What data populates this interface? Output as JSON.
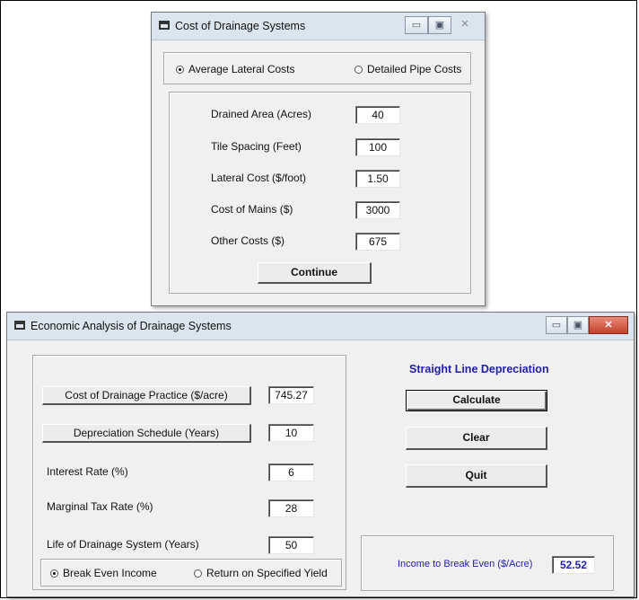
{
  "cost_window": {
    "title": "Cost of Drainage Systems",
    "controls": {
      "minimize": "▭",
      "maximize": "▣",
      "close": "✕"
    },
    "radio_average": "Average Lateral Costs",
    "radio_detailed": "Detailed Pipe Costs",
    "selected_radio": "average",
    "fields": [
      {
        "label": "Drained Area (Acres)",
        "value": "40"
      },
      {
        "label": "Tile Spacing (Feet)",
        "value": "100"
      },
      {
        "label": "Lateral Cost ($/foot)",
        "value": "1.50"
      },
      {
        "label": "Cost of Mains ($)",
        "value": "3000"
      },
      {
        "label": "Other Costs ($)",
        "value": "675"
      }
    ],
    "continue_label": "Continue"
  },
  "econ_window": {
    "title": "Economic Analysis of Drainage Systems",
    "controls": {
      "minimize": "▭",
      "maximize": "▣",
      "close": "✕"
    },
    "cost_practice_button": "Cost of Drainage Practice ($/acre)",
    "cost_practice_value": "745.27",
    "depreciation_button": "Depreciation Schedule (Years)",
    "depreciation_value": "10",
    "interest_label": "Interest Rate (%)",
    "interest_value": "6",
    "marginal_tax_label": "Marginal Tax Rate (%)",
    "marginal_tax_value": "28",
    "life_label": "Life of Drainage System (Years)",
    "life_value": "50",
    "radio_break_even": "Break Even Income",
    "radio_return": "Return on Specified Yield",
    "selected_radio": "break_even",
    "method_title": "Straight Line Depreciation",
    "calculate_label": "Calculate",
    "clear_label": "Clear",
    "quit_label": "Quit",
    "result_label": "Income to Break Even ($/Acre)",
    "result_value": "52.52"
  }
}
